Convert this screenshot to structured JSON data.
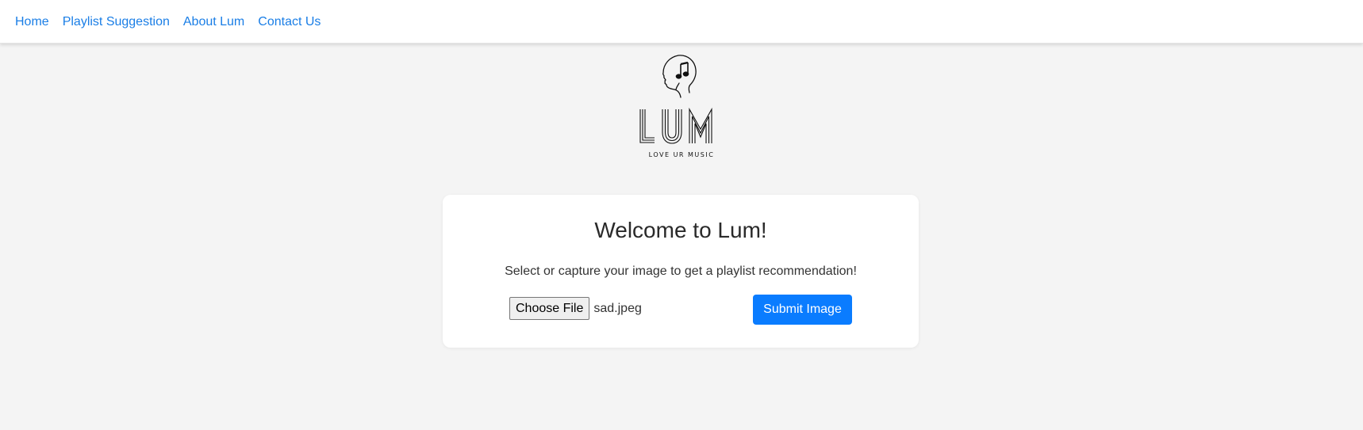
{
  "nav": {
    "items": [
      {
        "label": "Home"
      },
      {
        "label": "Playlist Suggestion"
      },
      {
        "label": "About Lum"
      },
      {
        "label": "Contact Us"
      }
    ]
  },
  "logo": {
    "wordmark": "LUM",
    "tagline": "LOVE UR MUSIC",
    "icon": "head-music-note-icon"
  },
  "card": {
    "title": "Welcome to Lum!",
    "description": "Select or capture your image to get a playlist recommendation!",
    "file_button_label": "Choose File",
    "file_name": "sad.jpeg",
    "submit_label": "Submit Image"
  },
  "colors": {
    "link": "#1a7ee6",
    "primary_button": "#0a7cff",
    "page_background": "#f4f4f4",
    "card_background": "#ffffff"
  }
}
